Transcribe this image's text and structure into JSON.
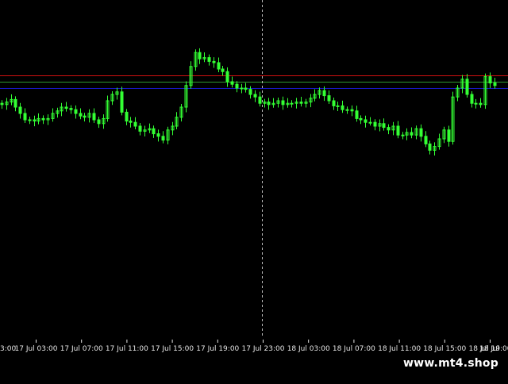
{
  "colors": {
    "background": "#000000",
    "candle": "#33ff33",
    "axis_text": "#e6e6e6",
    "red_level": "#d01010",
    "green_level": "#2f9a2f",
    "blue_level": "#1818c8",
    "separator": "#bbbbbb"
  },
  "watermark": "www.mt4.shop",
  "chart_data": {
    "type": "bar",
    "style": "candlestick-mt4",
    "title": "",
    "xlabel": "",
    "ylabel": "",
    "grid": false,
    "x_ticks": [
      "17 Jul 03:00",
      "17 Jul 07:00",
      "17 Jul 11:00",
      "17 Jul 15:00",
      "17 Jul 19:00",
      "17 Jul 23:00",
      "18 Jul 03:00",
      "18 Jul 07:00",
      "18 Jul 11:00",
      "18 Jul 15:00",
      "18 Jul 19:00"
    ],
    "x_tick_truncated_left": "3:00",
    "x_tick_truncated_right": "18 Jul",
    "y_range": [
      0,
      100
    ],
    "horizontal_levels": [
      {
        "color_key": "red_level",
        "value": 85
      },
      {
        "color_key": "green_level",
        "value": 80
      },
      {
        "color_key": "blue_level",
        "value": 75
      }
    ],
    "period_separator": "17 Jul 23:00",
    "close": [
      62,
      64,
      66,
      60,
      55,
      50,
      50,
      49,
      51,
      50,
      51,
      55,
      57,
      60,
      59,
      58,
      55,
      53,
      52,
      55,
      50,
      47,
      51,
      65,
      70,
      72,
      56,
      49,
      48,
      45,
      41,
      42,
      43,
      39,
      37,
      34,
      42,
      45,
      52,
      60,
      77,
      92,
      103,
      98,
      99,
      96,
      95,
      90,
      88,
      80,
      78,
      75,
      75,
      74,
      70,
      68,
      63,
      64,
      62,
      63,
      65,
      62,
      63,
      63,
      64,
      63,
      64,
      67,
      70,
      73,
      69,
      65,
      61,
      61,
      58,
      58,
      57,
      51,
      50,
      48,
      48,
      45,
      47,
      44,
      42,
      45,
      38,
      38,
      40,
      38,
      43,
      37,
      31,
      26,
      29,
      35,
      42,
      33,
      68,
      75,
      82,
      70,
      63,
      63,
      62,
      84,
      79,
      77
    ]
  }
}
